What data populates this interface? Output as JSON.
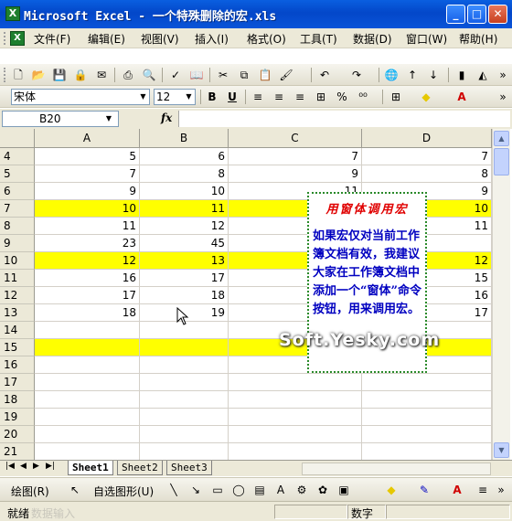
{
  "window": {
    "title": "Microsoft Excel - 一个特殊删除的宏.xls",
    "app_icon": "excel-icon",
    "controls": [
      "minimize",
      "maximize",
      "close"
    ]
  },
  "menu": {
    "items": [
      "文件(F)",
      "编辑(E)",
      "视图(V)",
      "插入(I)",
      "格式(O)",
      "工具(T)",
      "数据(D)",
      "窗口(W)",
      "帮助(H)"
    ]
  },
  "formatting": {
    "font": "宋体",
    "size": "12",
    "bold": "B",
    "underline": "U"
  },
  "formula_bar": {
    "name_box": "B20",
    "fx": "fx",
    "content": ""
  },
  "grid": {
    "columns": [
      "A",
      "B",
      "C",
      "D"
    ],
    "rows": [
      {
        "num": "4",
        "a": "5",
        "b": "6",
        "c": "7",
        "d": "7",
        "hl": false
      },
      {
        "num": "5",
        "a": "7",
        "b": "8",
        "c": "9",
        "d": "8",
        "hl": false
      },
      {
        "num": "6",
        "a": "9",
        "b": "10",
        "c": "11",
        "d": "9",
        "hl": false
      },
      {
        "num": "7",
        "a": "10",
        "b": "11",
        "c": "",
        "d": "10",
        "hl": true
      },
      {
        "num": "8",
        "a": "11",
        "b": "12",
        "c": "",
        "d": "11",
        "hl": false
      },
      {
        "num": "9",
        "a": "23",
        "b": "45",
        "c": "",
        "d": "",
        "hl": false
      },
      {
        "num": "10",
        "a": "12",
        "b": "13",
        "c": "",
        "d": "12",
        "hl": true
      },
      {
        "num": "11",
        "a": "16",
        "b": "17",
        "c": "",
        "d": "15",
        "hl": false
      },
      {
        "num": "12",
        "a": "17",
        "b": "18",
        "c": "",
        "d": "16",
        "hl": false
      },
      {
        "num": "13",
        "a": "18",
        "b": "19",
        "c": "",
        "d": "17",
        "hl": false
      },
      {
        "num": "14",
        "a": "",
        "b": "",
        "c": "",
        "d": "",
        "hl": false
      },
      {
        "num": "15",
        "a": "",
        "b": "",
        "c": "",
        "d": "",
        "hl": true
      },
      {
        "num": "16",
        "a": "",
        "b": "",
        "c": "",
        "d": "",
        "hl": false
      },
      {
        "num": "17",
        "a": "",
        "b": "",
        "c": "",
        "d": "",
        "hl": false
      },
      {
        "num": "18",
        "a": "",
        "b": "",
        "c": "",
        "d": "",
        "hl": false
      },
      {
        "num": "19",
        "a": "",
        "b": "",
        "c": "",
        "d": "",
        "hl": false
      },
      {
        "num": "20",
        "a": "",
        "b": "",
        "c": "",
        "d": "",
        "hl": false
      },
      {
        "num": "21",
        "a": "",
        "b": "",
        "c": "",
        "d": "",
        "hl": false
      }
    ]
  },
  "textbox": {
    "title": "用窗体调用宏",
    "body": "如果宏仅对当前工作簿文档有效，我建议大家在工作簿文档中添加一个“窗体”命令按钮，用来调用宏。"
  },
  "watermark": "Soft.Yesky.com",
  "sheets": {
    "tabs": [
      "Sheet1",
      "Sheet2",
      "Sheet3"
    ],
    "active": "Sheet1"
  },
  "drawing": {
    "draw_label": "绘图(R)",
    "autoshapes_label": "自选图形(U)"
  },
  "status": {
    "ready": "就绪",
    "extra": "数据输入",
    "mode": "数字"
  },
  "colors": {
    "highlight": "#ffff00",
    "textbox_title": "#e00000",
    "textbox_body": "#0000c0",
    "textbox_border": "#2a8a2a"
  }
}
